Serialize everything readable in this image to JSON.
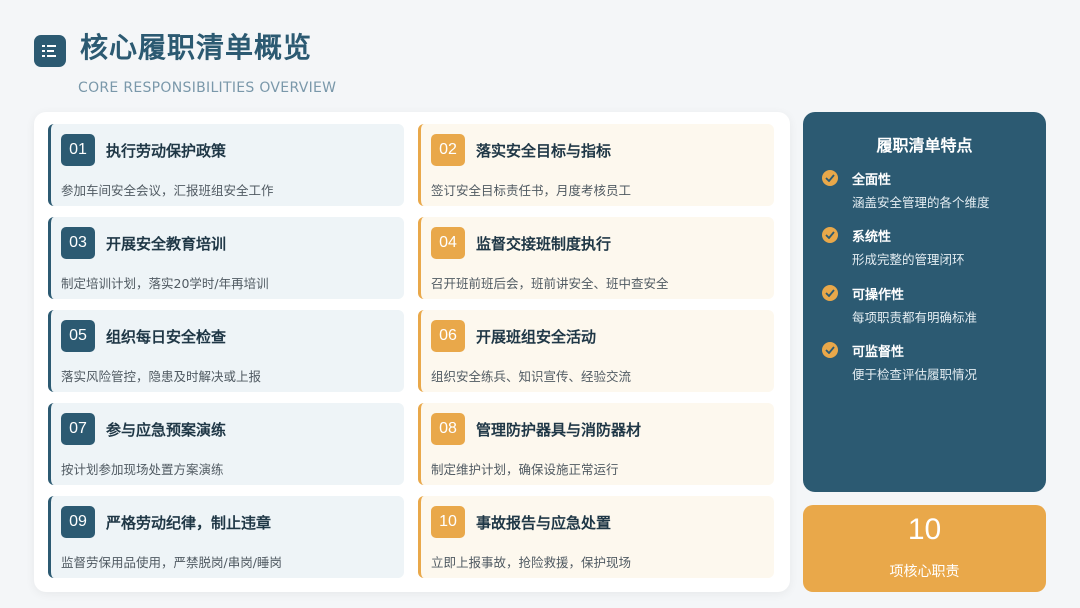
{
  "header": {
    "title": "核心履职清单概览",
    "subtitle": "CORE RESPONSIBILITIES OVERVIEW",
    "icon": "list-icon"
  },
  "colors": {
    "primary": "#2c5a72",
    "accent": "#e9a84a",
    "background": "#f4f6f8"
  },
  "items": [
    {
      "num": "01",
      "title": "执行劳动保护政策",
      "desc": "参加车间安全会议，汇报班组安全工作",
      "theme": "blue"
    },
    {
      "num": "02",
      "title": "落实安全目标与指标",
      "desc": "签订安全目标责任书，月度考核员工",
      "theme": "orange"
    },
    {
      "num": "03",
      "title": "开展安全教育培训",
      "desc": "制定培训计划，落实20学时/年再培训",
      "theme": "blue"
    },
    {
      "num": "04",
      "title": "监督交接班制度执行",
      "desc": "召开班前班后会，班前讲安全、班中查安全",
      "theme": "orange"
    },
    {
      "num": "05",
      "title": "组织每日安全检查",
      "desc": "落实风险管控，隐患及时解决或上报",
      "theme": "blue"
    },
    {
      "num": "06",
      "title": "开展班组安全活动",
      "desc": "组织安全练兵、知识宣传、经验交流",
      "theme": "orange"
    },
    {
      "num": "07",
      "title": "参与应急预案演练",
      "desc": "按计划参加现场处置方案演练",
      "theme": "blue"
    },
    {
      "num": "08",
      "title": "管理防护器具与消防器材",
      "desc": "制定维护计划，确保设施正常运行",
      "theme": "orange"
    },
    {
      "num": "09",
      "title": "严格劳动纪律，制止违章",
      "desc": "监督劳保用品使用，严禁脱岗/串岗/睡岗",
      "theme": "blue"
    },
    {
      "num": "10",
      "title": "事故报告与应急处置",
      "desc": "立即上报事故，抢险救援，保护现场",
      "theme": "orange"
    }
  ],
  "features": {
    "title": "履职清单特点",
    "items": [
      {
        "name": "全面性",
        "desc": "涵盖安全管理的各个维度"
      },
      {
        "name": "系统性",
        "desc": "形成完整的管理闭环"
      },
      {
        "name": "可操作性",
        "desc": "每项职责都有明确标准"
      },
      {
        "name": "可监督性",
        "desc": "便于检查评估履职情况"
      }
    ]
  },
  "summary": {
    "count": "10",
    "label": "项核心职责"
  }
}
